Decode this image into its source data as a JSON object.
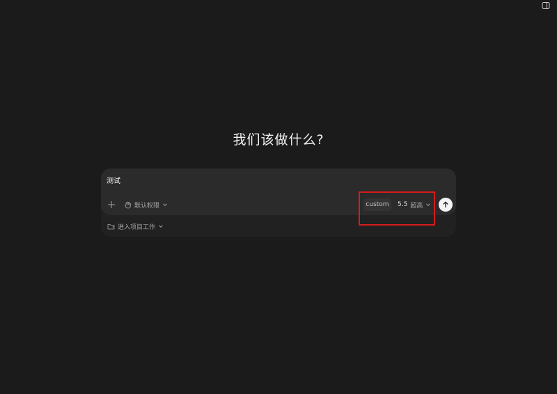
{
  "header": {
    "sidebar_toggle_icon": "panel-toggle-icon"
  },
  "main": {
    "heading": "我们该做什么?"
  },
  "composer": {
    "input_value": "测试",
    "add_icon": "plus-icon",
    "permission": {
      "icon": "hand-icon",
      "label": "默认权限"
    },
    "custom_label": "custom",
    "model": {
      "version": "5.5",
      "effort": "超高"
    },
    "send_icon": "arrow-up-icon",
    "project": {
      "icon": "folder-icon",
      "label": "进入项目工作"
    }
  },
  "colors": {
    "background": "#1b1b1b",
    "composer": "#2b2b2b",
    "composer_footer": "#212121",
    "highlight": "#d61b1b",
    "send_button": "#f4f4f4"
  }
}
